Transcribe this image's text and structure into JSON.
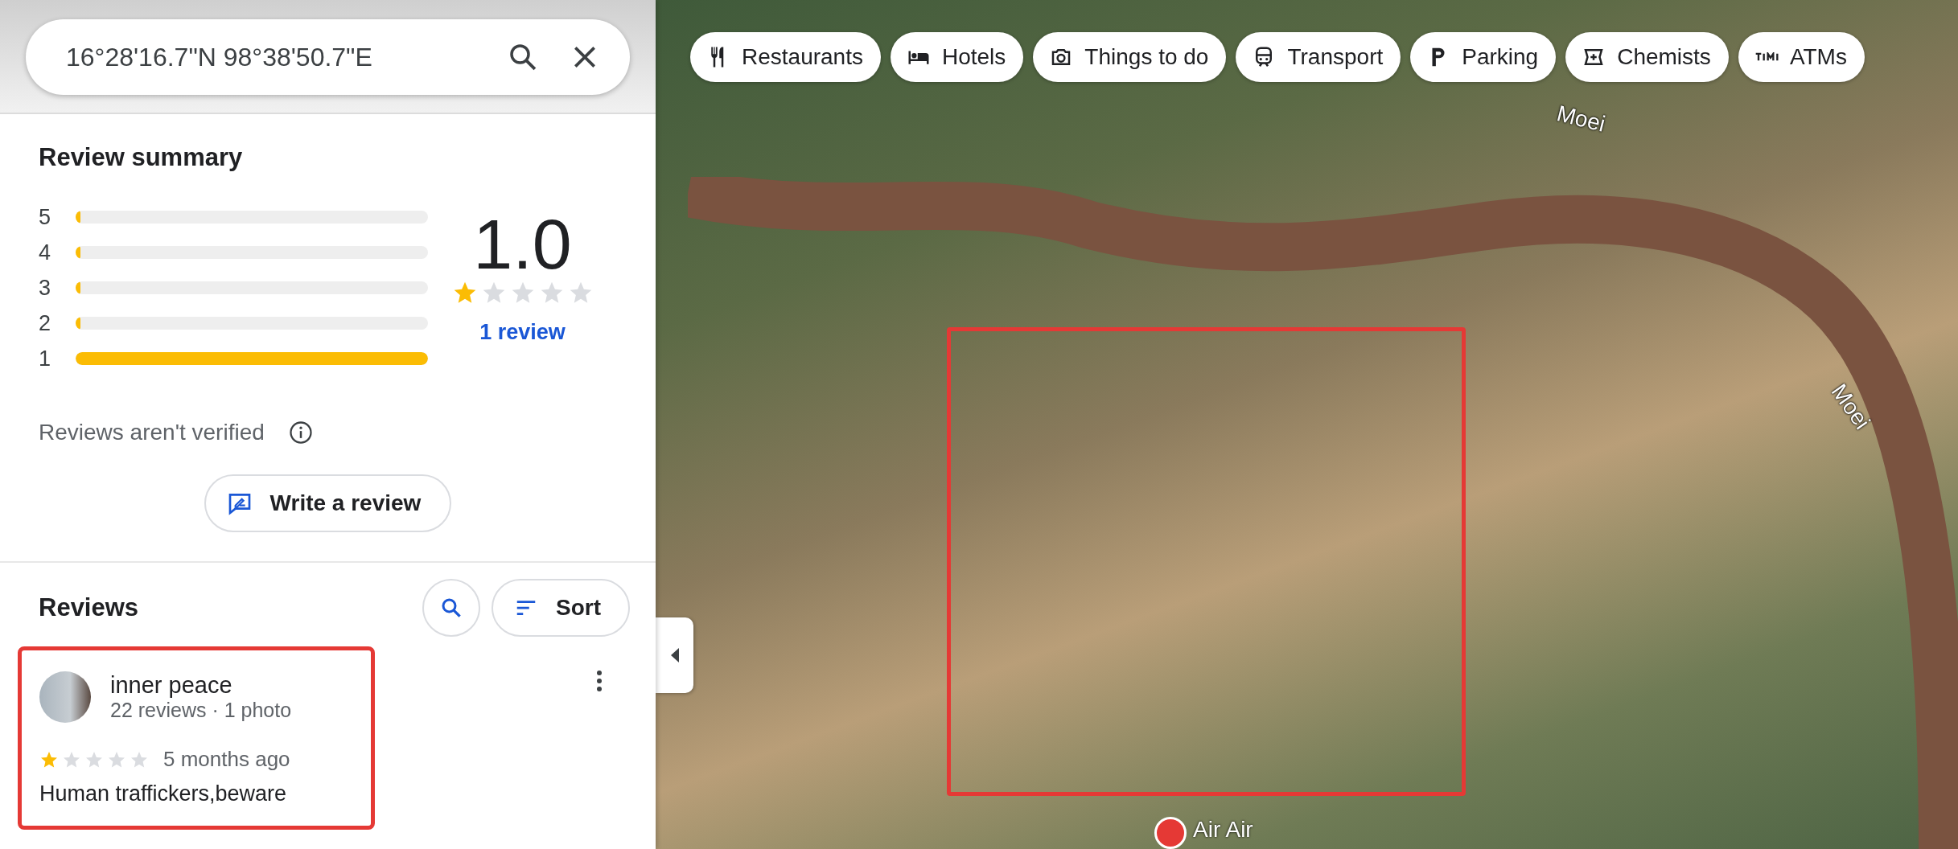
{
  "search": {
    "value": "16°28'16.7\"N 98°38'50.7\"E"
  },
  "review_summary": {
    "title": "Review summary",
    "distribution": [
      {
        "label": "5",
        "level": 0
      },
      {
        "label": "4",
        "level": 0
      },
      {
        "label": "3",
        "level": 0
      },
      {
        "label": "2",
        "level": 0
      },
      {
        "label": "1",
        "level": 1
      }
    ],
    "rating": "1.0",
    "stars": 1,
    "review_count_link": "1 review",
    "notice": "Reviews aren't verified",
    "write_button": "Write a review"
  },
  "reviews": {
    "title": "Reviews",
    "sort_button": "Sort",
    "items": [
      {
        "author": "inner peace",
        "meta": "22 reviews · 1 photo",
        "stars": 1,
        "time": "5 months ago",
        "text": "Human traffickers,beware",
        "highlighted": true
      }
    ]
  },
  "map": {
    "chips": [
      {
        "label": "Restaurants",
        "kind": "restaurant"
      },
      {
        "label": "Hotels",
        "kind": "hotel"
      },
      {
        "label": "Things to do",
        "kind": "camera"
      },
      {
        "label": "Transport",
        "kind": "transit"
      },
      {
        "label": "Parking",
        "kind": "parking"
      },
      {
        "label": "Chemists",
        "kind": "pharmacy"
      },
      {
        "label": "ATMs",
        "kind": "atm"
      }
    ],
    "labels": [
      {
        "text": "Moei"
      },
      {
        "text": "Moei"
      }
    ],
    "pin_label": "Air Air"
  }
}
